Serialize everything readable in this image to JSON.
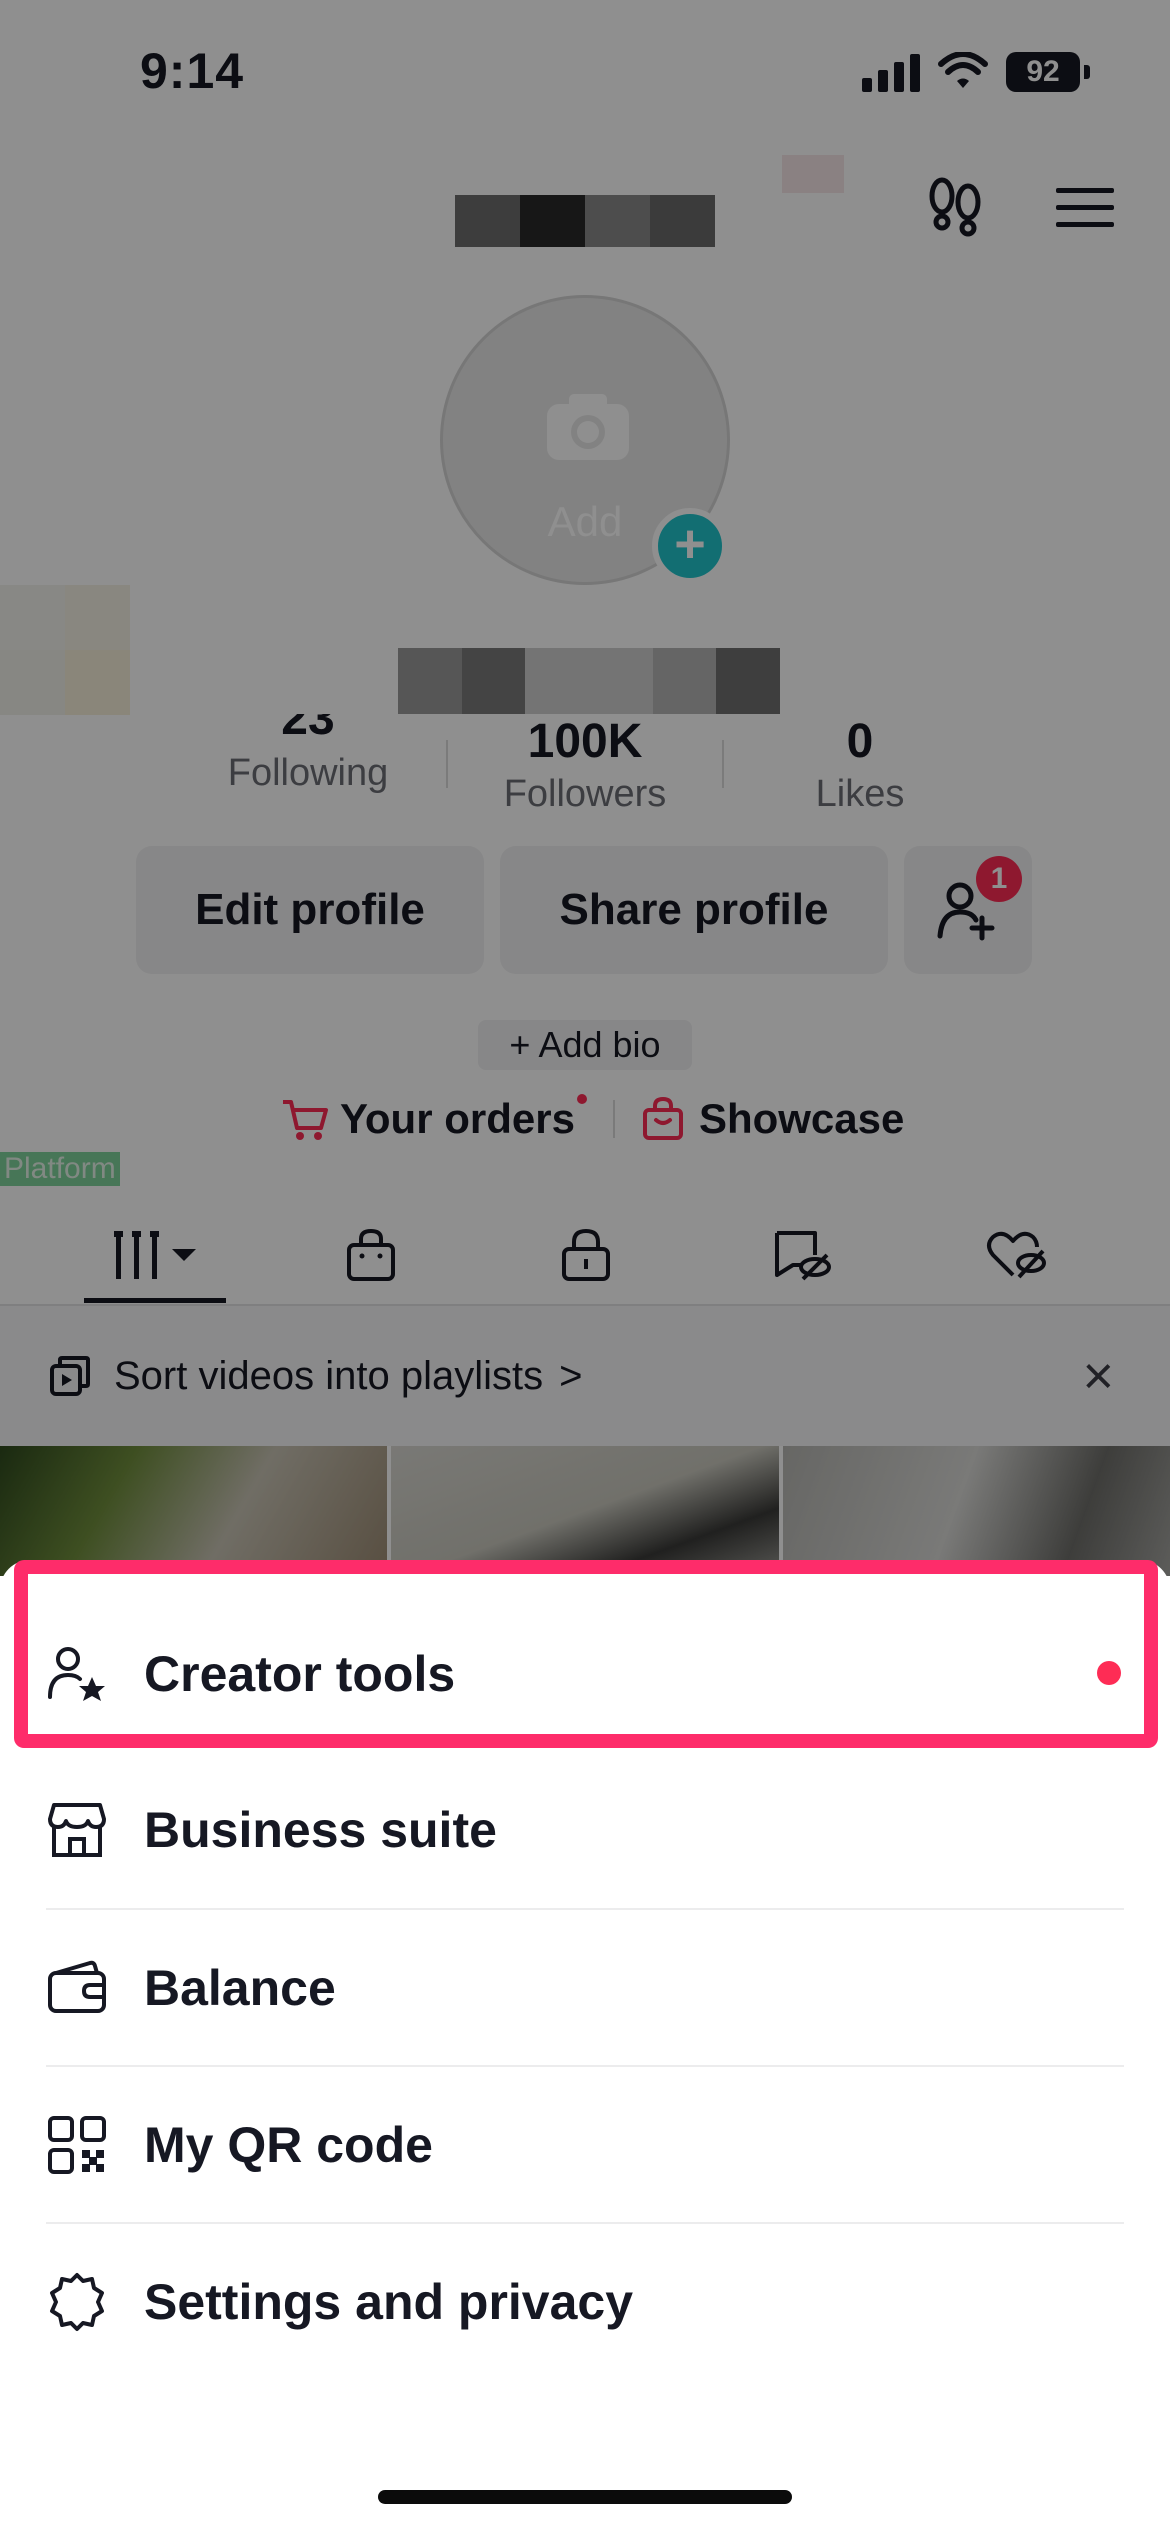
{
  "status_bar": {
    "time": "9:14",
    "battery": "92"
  },
  "profile": {
    "avatar_label": "Add",
    "avatar_plus": "+",
    "stats": [
      {
        "value": "23",
        "label": "Following"
      },
      {
        "value": "100K",
        "label": "Followers"
      },
      {
        "value": "0",
        "label": "Likes"
      }
    ],
    "edit_profile": "Edit profile",
    "share_profile": "Share profile",
    "friend_badge": "1",
    "add_bio": "+ Add bio",
    "your_orders": "Your orders",
    "showcase": "Showcase",
    "platform_tag": "Platform"
  },
  "tabs": [
    {
      "icon": "grid-icon"
    },
    {
      "icon": "shopping-bag-icon"
    },
    {
      "icon": "lock-icon"
    },
    {
      "icon": "hidden-tag-icon"
    },
    {
      "icon": "hidden-heart-icon"
    }
  ],
  "playlist_banner": {
    "text": "Sort videos into playlists",
    "chevron": ">",
    "close": "×"
  },
  "menu": [
    {
      "label": "Creator tools",
      "icon": "person-star-icon",
      "highlighted": true,
      "dot": true
    },
    {
      "label": "Business suite",
      "icon": "storefront-icon"
    },
    {
      "label": "Balance",
      "icon": "wallet-icon"
    },
    {
      "label": "My QR code",
      "icon": "qr-code-icon"
    },
    {
      "label": "Settings and privacy",
      "icon": "gear-icon"
    }
  ],
  "colors": {
    "accent": "#fe2c55",
    "highlight_box": "#fe2c6a",
    "teal": "#20c4cc"
  }
}
